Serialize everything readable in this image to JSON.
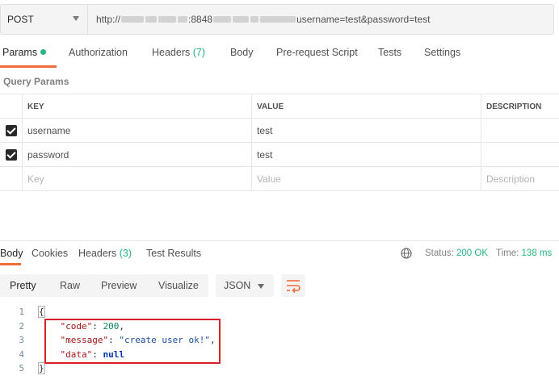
{
  "request": {
    "method": "POST",
    "url_prefix": "http://",
    "url_port": ":8848",
    "url_suffix": "username=test&password=test"
  },
  "tabs": {
    "params": "Params",
    "authorization": "Authorization",
    "headers": "Headers",
    "headers_count": "(7)",
    "body": "Body",
    "prerequest": "Pre-request Script",
    "tests": "Tests",
    "settings": "Settings"
  },
  "query_params": {
    "title": "Query Params",
    "headers": {
      "key": "KEY",
      "value": "VALUE",
      "description": "DESCRIPTION"
    },
    "rows": [
      {
        "key": "username",
        "value": "test",
        "checked": true
      },
      {
        "key": "password",
        "value": "test",
        "checked": true
      }
    ],
    "placeholders": {
      "key": "Key",
      "value": "Value",
      "description": "Description"
    }
  },
  "response": {
    "tabs": {
      "body": "Body",
      "cookies": "Cookies",
      "headers": "Headers",
      "headers_count": "(3)",
      "test_results": "Test Results"
    },
    "status_label": "Status:",
    "status_value": "200 OK",
    "time_label": "Time:",
    "time_value": "138 ms",
    "views": {
      "pretty": "Pretty",
      "raw": "Raw",
      "preview": "Preview",
      "visualize": "Visualize"
    },
    "format": "JSON",
    "code": {
      "line_numbers": [
        "1",
        "2",
        "3",
        "4",
        "5"
      ],
      "open_brace": "{",
      "close_brace": "}",
      "code_key": "\"code\"",
      "code_value": "200",
      "message_key": "\"message\"",
      "message_value": "\"create user ok!\"",
      "data_key": "\"data\"",
      "data_value": "null"
    }
  },
  "colors": {
    "accent": "#f26b3a",
    "success": "#26b47f",
    "highlight_box": "#d8202a"
  }
}
